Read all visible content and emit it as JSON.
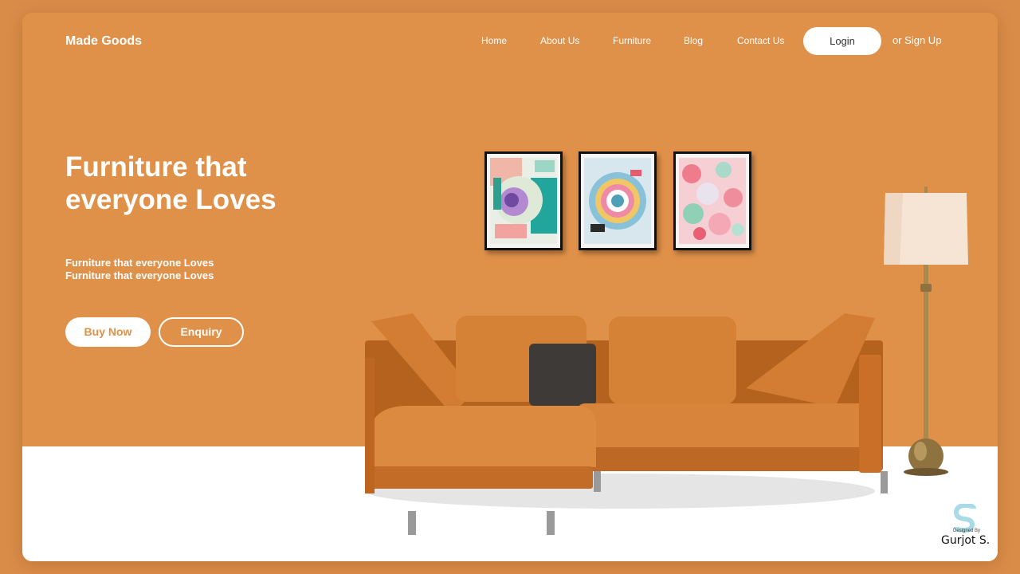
{
  "brand": "Made Goods",
  "nav": {
    "links": [
      "Home",
      "About Us",
      "Furniture",
      "Blog",
      "Contact Us"
    ],
    "login_label": "Login",
    "signup_label": "or Sign Up"
  },
  "hero": {
    "title": "Furniture that everyone Loves",
    "subtitle": "Furniture that everyone Loves Furniture that everyone Loves",
    "buy_label": "Buy Now",
    "enquiry_label": "Enquiry"
  },
  "credit": {
    "small": "Designed By",
    "name": "Gurjot S."
  },
  "colors": {
    "accent": "#e09149",
    "sofa": "#cf7a2e",
    "pillow_dark": "#3e3a38",
    "lamp_shade": "#f6e4d4",
    "lamp_brass": "#a8894f"
  },
  "icons": {
    "logo": "s-logo-icon"
  }
}
